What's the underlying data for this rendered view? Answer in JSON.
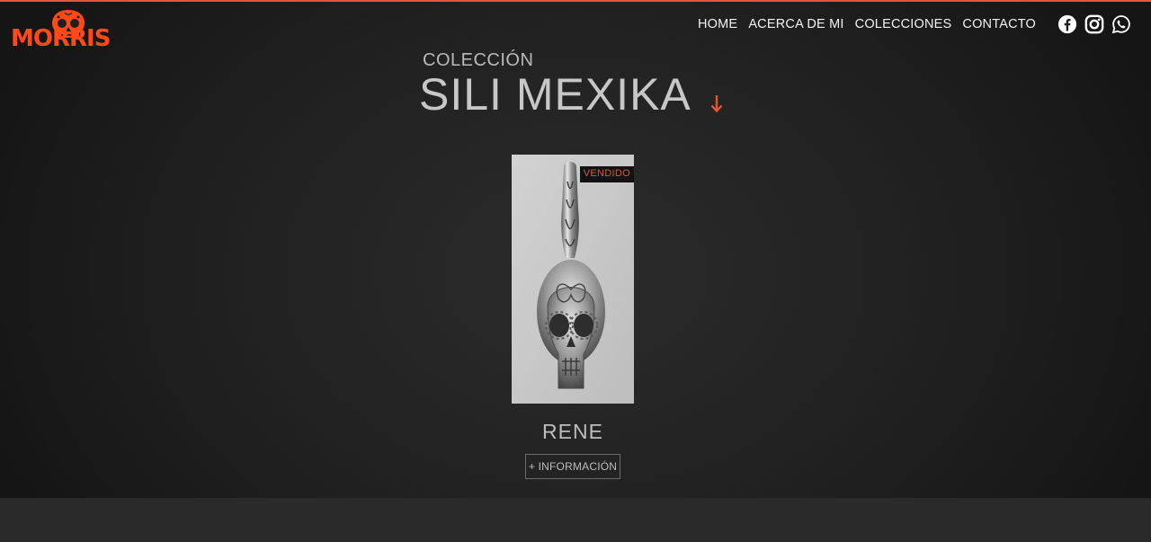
{
  "brand": {
    "logo_text": "MORRIS",
    "logo_color": "#ff4a17"
  },
  "nav": {
    "items": [
      "HOME",
      "ACERCA DE MI",
      "COLECCIONES",
      "CONTACTO"
    ]
  },
  "social": {
    "icons": [
      "facebook-icon",
      "instagram-icon",
      "whatsapp-icon"
    ]
  },
  "collection": {
    "kicker": "COLECCIÓN",
    "title": "SILI MEXIKA",
    "arrow_icon": "arrow-down-icon",
    "accent_color": "#e4572e"
  },
  "products": [
    {
      "name": "RENE",
      "badge": "VENDIDO",
      "button_label": "+ INFORMACIÓN"
    }
  ]
}
